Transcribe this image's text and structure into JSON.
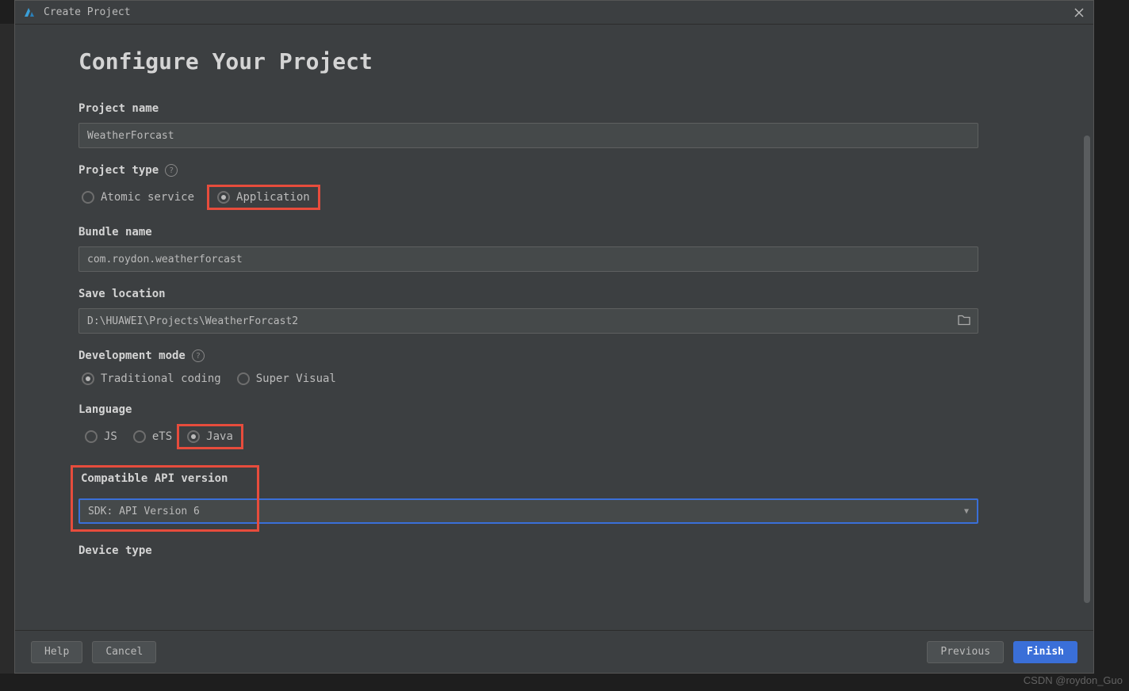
{
  "titlebar": {
    "title": "Create Project"
  },
  "page": {
    "heading": "Configure Your Project"
  },
  "fields": {
    "project_name": {
      "label": "Project name",
      "value": "WeatherForcast"
    },
    "project_type": {
      "label": "Project type",
      "options": [
        "Atomic service",
        "Application"
      ],
      "selected": "Application"
    },
    "bundle_name": {
      "label": "Bundle name",
      "value": "com.roydon.weatherforcast"
    },
    "save_location": {
      "label": "Save location",
      "value": "D:\\HUAWEI\\Projects\\WeatherForcast2"
    },
    "dev_mode": {
      "label": "Development mode",
      "options": [
        "Traditional coding",
        "Super Visual"
      ],
      "selected": "Traditional coding"
    },
    "language": {
      "label": "Language",
      "options": [
        "JS",
        "eTS",
        "Java"
      ],
      "selected": "Java"
    },
    "api_version": {
      "label": "Compatible API version",
      "value": "SDK: API Version 6"
    },
    "device_type": {
      "label": "Device type"
    }
  },
  "footer": {
    "help": "Help",
    "cancel": "Cancel",
    "previous": "Previous",
    "finish": "Finish"
  },
  "watermark": "CSDN @roydon_Guo"
}
